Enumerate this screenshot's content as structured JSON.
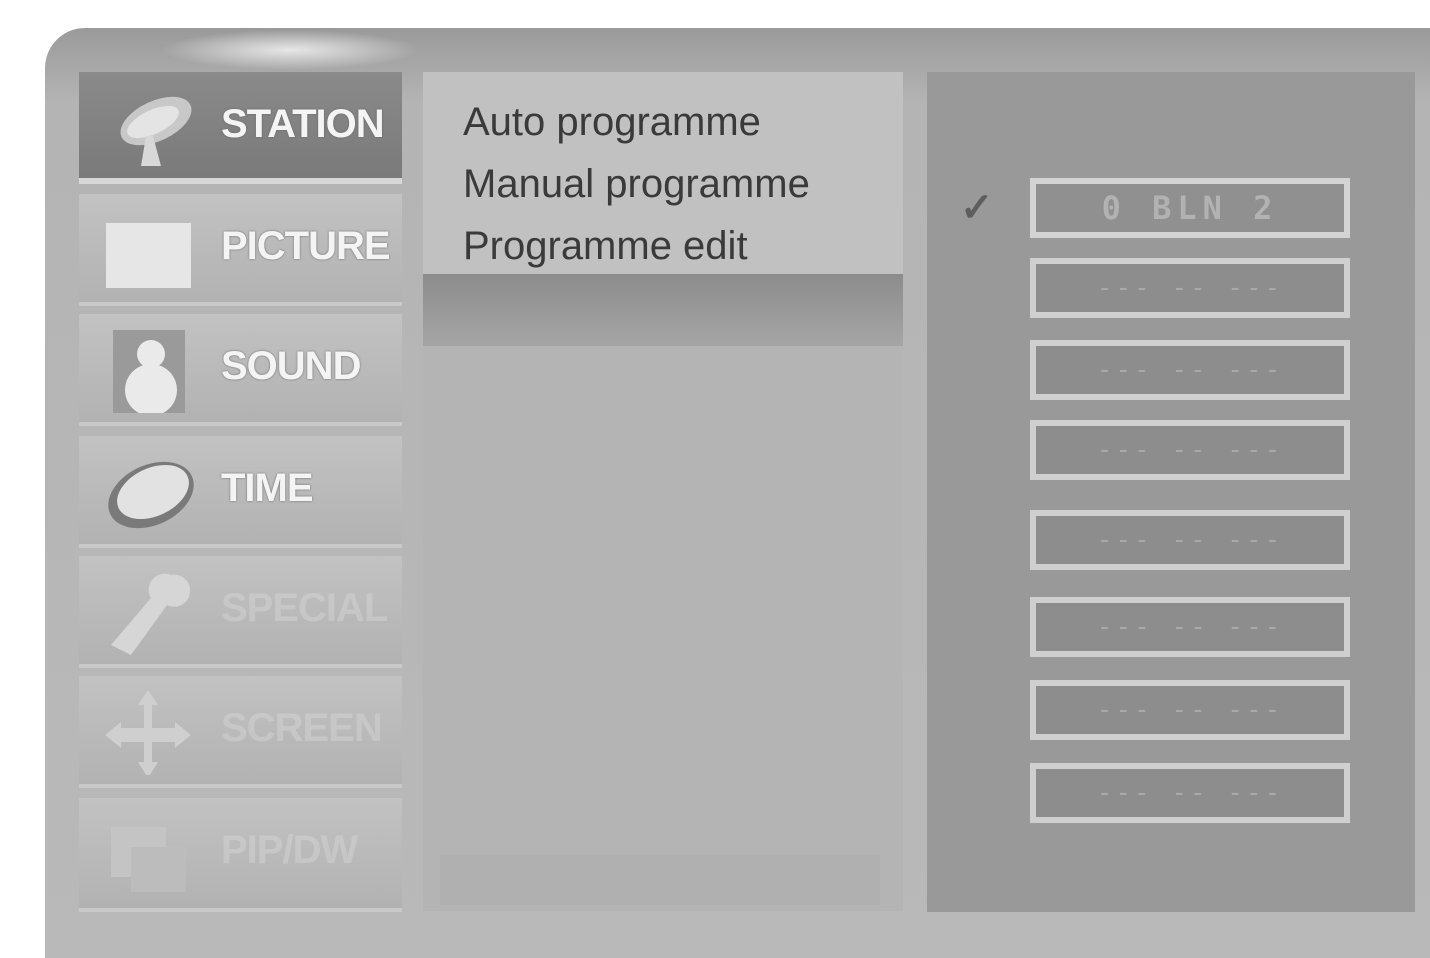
{
  "menu": {
    "items": [
      {
        "label": "STATION",
        "icon": "satellite-dish-icon"
      },
      {
        "label": "PICTURE",
        "icon": "monitor-icon"
      },
      {
        "label": "SOUND",
        "icon": "speaker-icon"
      },
      {
        "label": "TIME",
        "icon": "clock-icon"
      },
      {
        "label": "SPECIAL",
        "icon": "wrench-icon"
      },
      {
        "label": "SCREEN",
        "icon": "move-arrows-icon"
      },
      {
        "label": "PIP/DW",
        "icon": "pip-icon"
      }
    ]
  },
  "submenu": {
    "items": [
      "Auto programme",
      "Manual programme",
      "Programme edit"
    ]
  },
  "programmes": {
    "check": "✓",
    "slots": [
      "0 BLN 2",
      "--- -- ---",
      "--- -- ---",
      "--- -- ---",
      "--- -- ---",
      "--- -- ---",
      "--- -- ---",
      "--- -- ---"
    ]
  },
  "colors": {
    "selected_menu_bg": "#7e7e7e",
    "panel_bg": "#b4b4b4",
    "right_panel_bg": "#999999"
  }
}
